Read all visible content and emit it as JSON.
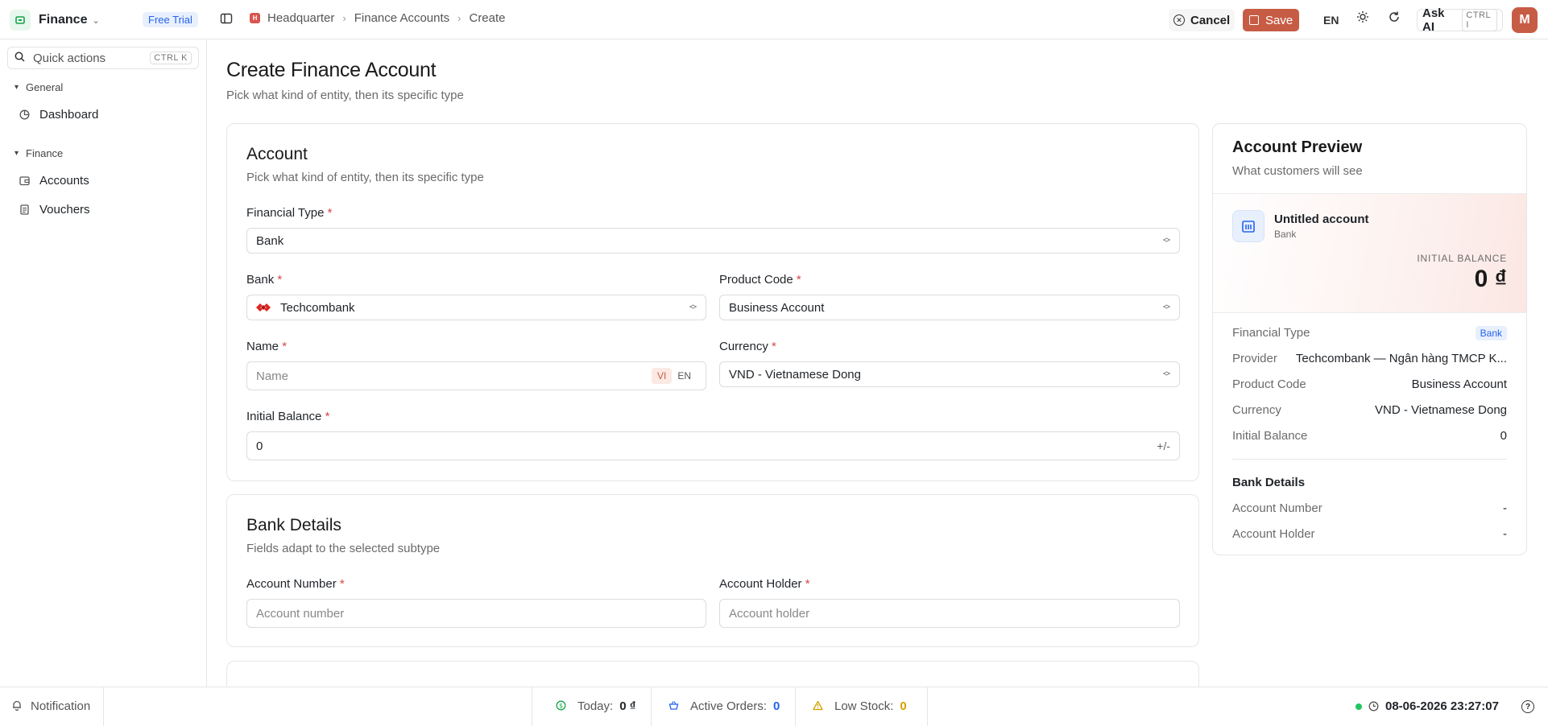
{
  "app": {
    "name": "Finance",
    "trial_badge": "Free Trial",
    "avatar_initial": "M",
    "brand_color": "#c75c45"
  },
  "breadcrumb": {
    "items": [
      "Headquarter",
      "Finance Accounts",
      "Create"
    ],
    "logo_letter": "H"
  },
  "toolbar": {
    "cancel_label": "Cancel",
    "save_label": "Save",
    "language": "EN",
    "ask_ai_label": "Ask AI",
    "ask_ai_shortcut": "CTRL I"
  },
  "sidebar": {
    "quick_actions": {
      "label": "Quick actions",
      "shortcut": "CTRL K"
    },
    "groups": [
      {
        "label": "General",
        "items": [
          {
            "label": "Dashboard",
            "icon": "dashboard-icon"
          }
        ]
      },
      {
        "label": "Finance",
        "items": [
          {
            "label": "Accounts",
            "icon": "wallet-icon"
          },
          {
            "label": "Vouchers",
            "icon": "document-icon"
          }
        ]
      }
    ]
  },
  "page": {
    "title": "Create Finance Account",
    "subtitle": "Pick what kind of entity, then its specific type"
  },
  "account_card": {
    "title": "Account",
    "subtitle": "Pick what kind of entity, then its specific type",
    "financial_type": {
      "label": "Financial Type",
      "value": "Bank"
    },
    "bank": {
      "label": "Bank",
      "value": "Techcombank"
    },
    "product_code": {
      "label": "Product Code",
      "value": "Business Account"
    },
    "name": {
      "label": "Name",
      "placeholder": "Name",
      "lang_active": "VI",
      "lang_other": "EN"
    },
    "currency": {
      "label": "Currency",
      "value": "VND - Vietnamese Dong"
    },
    "initial_balance": {
      "label": "Initial Balance",
      "value": "0",
      "sign_toggle": "+/-"
    },
    "required_mark": "*"
  },
  "bank_details_card": {
    "title": "Bank Details",
    "subtitle": "Fields adapt to the selected subtype",
    "account_number": {
      "label": "Account Number",
      "placeholder": "Account number"
    },
    "account_holder": {
      "label": "Account Holder",
      "placeholder": "Account holder"
    }
  },
  "preview": {
    "title": "Account Preview",
    "subtitle": "What customers will see",
    "account_name": "Untitled account",
    "account_type": "Bank",
    "initial_balance_label": "INITIAL BALANCE",
    "initial_balance_value": "0 ₫",
    "rows": [
      {
        "key": "Financial Type",
        "value": "Bank",
        "badge": true
      },
      {
        "key": "Provider",
        "value": "Techcombank — Ngân hàng TMCP K..."
      },
      {
        "key": "Product Code",
        "value": "Business Account"
      },
      {
        "key": "Currency",
        "value": "VND - Vietnamese Dong"
      },
      {
        "key": "Initial Balance",
        "value": "0"
      }
    ],
    "bank_details_heading": "Bank Details",
    "bank_rows": [
      {
        "key": "Account Number",
        "value": "-"
      },
      {
        "key": "Account Holder",
        "value": "-"
      }
    ]
  },
  "statusbar": {
    "notification_label": "Notification",
    "today": {
      "label": "Today:",
      "value": "0 ₫"
    },
    "active_orders": {
      "label": "Active Orders:",
      "value": "0"
    },
    "low_stock": {
      "label": "Low Stock:",
      "value": "0"
    },
    "datetime": "08-06-2026 23:27:07"
  }
}
